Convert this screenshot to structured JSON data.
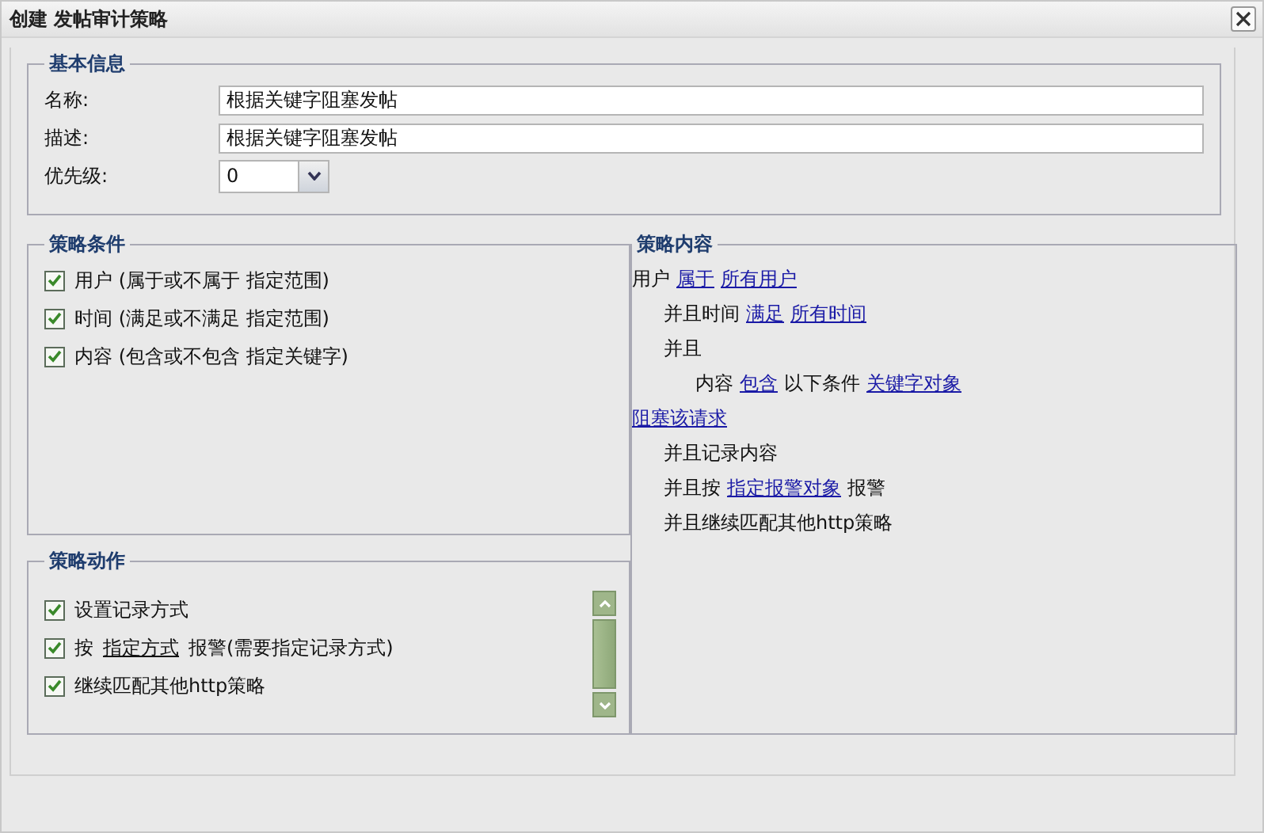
{
  "window": {
    "title": "创建 发帖审计策略"
  },
  "basic_info": {
    "legend": "基本信息",
    "fields": [
      {
        "label": "名称:",
        "value": "根据关键字阻塞发帖",
        "kind": "text"
      },
      {
        "label": "描述:",
        "value": "根据关键字阻塞发帖",
        "kind": "text"
      },
      {
        "label": "优先级:",
        "value": "0",
        "kind": "select"
      }
    ]
  },
  "conditions": {
    "legend": "策略条件",
    "items": [
      {
        "label": "用户 (属于或不属于 指定范围)",
        "checked": true
      },
      {
        "label": "时间 (满足或不满足 指定范围)",
        "checked": true
      },
      {
        "label": "内容 (包含或不包含 指定关键字)",
        "checked": true
      }
    ]
  },
  "actions": {
    "legend": "策略动作",
    "items": [
      {
        "checked": true,
        "parts": [
          {
            "kind": "text",
            "text": "设置记录方式"
          }
        ]
      },
      {
        "checked": true,
        "parts": [
          {
            "kind": "text",
            "text": "按"
          },
          {
            "kind": "link",
            "text": "指定方式"
          },
          {
            "kind": "text",
            "text": "报警(需要指定记录方式)"
          }
        ]
      },
      {
        "checked": true,
        "parts": [
          {
            "kind": "text",
            "text": "继续匹配其他http策略"
          }
        ]
      }
    ]
  },
  "content": {
    "legend": "策略内容",
    "lines": [
      {
        "parts": [
          {
            "kind": "text",
            "text": "用户"
          },
          {
            "kind": "link",
            "text": "属于"
          },
          {
            "kind": "link",
            "text": "所有用户"
          }
        ],
        "children": [
          {
            "parts": [
              {
                "kind": "text",
                "text": "并且时间"
              },
              {
                "kind": "link",
                "text": "满足"
              },
              {
                "kind": "link",
                "text": "所有时间"
              }
            ]
          },
          {
            "parts": [
              {
                "kind": "text",
                "text": "并且"
              }
            ],
            "children": [
              {
                "parts": [
                  {
                    "kind": "text",
                    "text": "内容"
                  },
                  {
                    "kind": "link",
                    "text": "包含"
                  },
                  {
                    "kind": "text",
                    "text": "以下条件"
                  },
                  {
                    "kind": "link",
                    "text": "关键字对象"
                  }
                ]
              }
            ]
          }
        ]
      },
      {
        "parts": [
          {
            "kind": "link",
            "text": "阻塞该请求"
          }
        ],
        "children": [
          {
            "parts": [
              {
                "kind": "text",
                "text": "并且记录内容"
              }
            ]
          },
          {
            "parts": [
              {
                "kind": "text",
                "text": "并且按"
              },
              {
                "kind": "link",
                "text": "指定报警对象"
              },
              {
                "kind": "text",
                "text": "报警"
              }
            ]
          },
          {
            "parts": [
              {
                "kind": "text",
                "text": "并且继续匹配其他http策略"
              }
            ]
          }
        ]
      }
    ]
  }
}
